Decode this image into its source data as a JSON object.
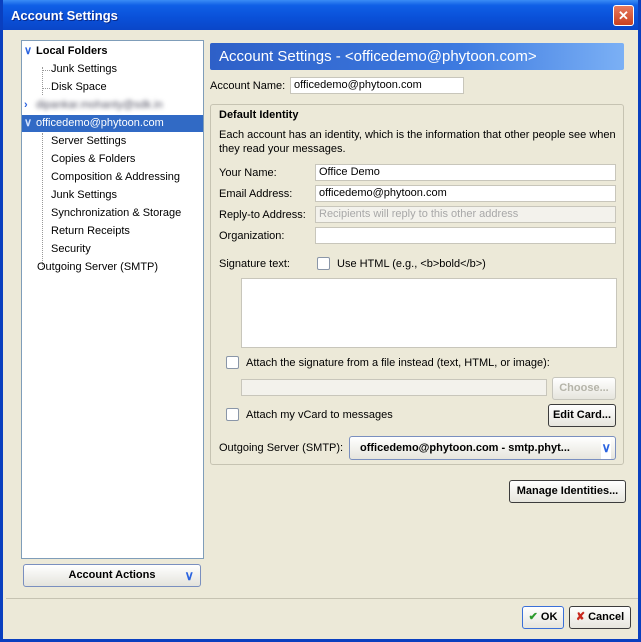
{
  "window": {
    "title": "Account Settings",
    "close_glyph": "✕"
  },
  "tree": {
    "local_folders": "Local Folders",
    "junk_settings": "Junk Settings",
    "disk_space": "Disk Space",
    "blurred_account": "dipankar.mohanty@sdk.in",
    "account": "officedemo@phytoon.com",
    "server_settings": "Server Settings",
    "copies_folders": "Copies & Folders",
    "composition": "Composition & Addressing",
    "junk_settings2": "Junk Settings",
    "sync_storage": "Synchronization & Storage",
    "return_receipts": "Return Receipts",
    "security": "Security",
    "outgoing_server": "Outgoing Server (SMTP)"
  },
  "account_actions": "Account Actions",
  "header": {
    "title": "Account Settings - <officedemo@phytoon.com>"
  },
  "account_name": {
    "label": "Account Name:",
    "value": "officedemo@phytoon.com"
  },
  "identity": {
    "group_title": "Default Identity",
    "description": "Each account has an identity, which is the information that other people see when they read your messages.",
    "your_name_label": "Your Name:",
    "your_name_value": "Office Demo",
    "email_label": "Email Address:",
    "email_value": "officedemo@phytoon.com",
    "reply_to_label": "Reply-to Address:",
    "reply_to_placeholder": "Recipients will reply to this other address",
    "org_label": "Organization:",
    "org_value": "",
    "sig_label": "Signature text:",
    "use_html_label": "Use HTML (e.g., <b>bold</b>)",
    "attach_sig_label": "Attach the signature from a file instead (text, HTML, or image):",
    "choose_button": "Choose...",
    "attach_vcard_label": "Attach my vCard to messages",
    "edit_card_button": "Edit Card...",
    "smtp_label": "Outgoing Server (SMTP):",
    "smtp_value": "officedemo@phytoon.com - smtp.phyt..."
  },
  "manage_identities": "Manage Identities...",
  "ok_button": "OK",
  "cancel_button": "Cancel",
  "icons": {
    "ok": "check-icon",
    "cancel": "x-icon",
    "dropdown": "chevron-down-icon"
  }
}
